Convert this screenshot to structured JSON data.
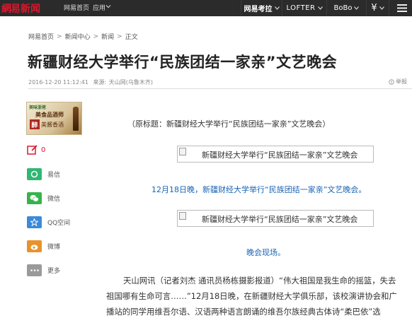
{
  "topbar": {
    "logo_main": "網易",
    "logo_sub": "新闻",
    "home_link": "网易首页",
    "apps_link": "应用",
    "right_items": [
      "网易考拉",
      "LOFTER",
      "BoBo",
      "¥"
    ]
  },
  "breadcrumb": {
    "items": [
      "网易首页",
      "新闻中心",
      "新闻",
      "正文"
    ],
    "separator": ">"
  },
  "article": {
    "title": "新疆财经大学举行“民族团结一家亲”文艺晚会",
    "date": "2016-12-20 11:12:41",
    "source_label": "来源:",
    "source": "天山网(乌鲁木齐)",
    "report_label": "举报",
    "original_title": "（原标题：新疆财经大学举行“民族团结一家亲”文艺晚会）",
    "image_alt": "新疆财经大学举行“民族团结一家亲”文艺晚会",
    "caption1": "12月18日晚，新疆财经大学举行“民族团结一家亲”文艺晚会。",
    "caption2": "晚会现场。",
    "body_lines": [
      "天山网讯（记者刘杰 通讯员杨栋摄影报道）“伟大祖国是我生命的摇篮，失去",
      "祖国哪有生命可言……”12月18日晚，在新疆财经大学俱乐部，该校演讲协会和广",
      "播站的同学用维吾尔语、汉语两种语言朗诵的维吾尔族经典古体诗“柔巴依”选"
    ]
  },
  "ad": {
    "brand": "美味浙佬",
    "line1": "美食品酒师",
    "badge": "醉",
    "line2": "美酱香酒"
  },
  "share": {
    "comment_count": "0",
    "items": [
      {
        "label": "易信",
        "color": "#2eb872"
      },
      {
        "label": "微信",
        "color": "#36b34a"
      },
      {
        "label": "QQ空间",
        "color": "#3b8ad8"
      },
      {
        "label": "微博",
        "color": "#e8922c"
      },
      {
        "label": "更多",
        "color": "#9a9a9a"
      }
    ]
  }
}
